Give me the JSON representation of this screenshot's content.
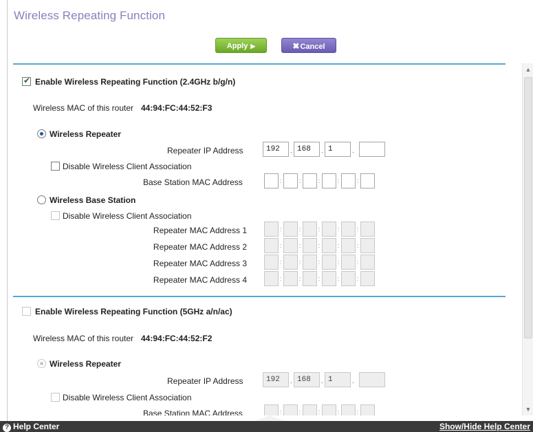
{
  "page": {
    "title": "Wireless Repeating Function",
    "apply_label": "Apply",
    "cancel_label": "Cancel"
  },
  "band24": {
    "enable_label": "Enable Wireless Repeating Function (2.4GHz b/g/n)",
    "enabled": true,
    "mac_prefix": "Wireless MAC of this router",
    "mac_value": "44:94:FC:44:52:F3",
    "repeater_label": "Wireless Repeater",
    "repeater_ip_label": "Repeater IP Address",
    "repeater_ip": [
      "192",
      "168",
      "1",
      ""
    ],
    "disable_assoc_label": "Disable Wireless Client Association",
    "base_mac_label": "Base Station MAC Address",
    "base_station_label": "Wireless Base Station",
    "base_disable_assoc_label": "Disable Wireless Client Association",
    "repeater_mac_labels": [
      "Repeater MAC Address 1",
      "Repeater MAC Address 2",
      "Repeater MAC Address 3",
      "Repeater MAC Address 4"
    ]
  },
  "band5": {
    "enable_label": "Enable Wireless Repeating Function (5GHz a/n/ac)",
    "enabled": false,
    "mac_prefix": "Wireless MAC of this router",
    "mac_value": "44:94:FC:44:52:F2",
    "repeater_label": "Wireless Repeater",
    "repeater_ip_label": "Repeater IP Address",
    "repeater_ip": [
      "192",
      "168",
      "1",
      ""
    ],
    "disable_assoc_label": "Disable Wireless Client Association",
    "base_mac_label": "Base Station MAC Address"
  },
  "footer": {
    "help_label": "Help Center",
    "toggle_label": "Show/Hide Help Center"
  },
  "colors": {
    "title": "#8a7fbd",
    "apply": "#7cba34",
    "cancel": "#7b6dc0",
    "rule": "#5aa7cf",
    "footer": "#3a3a3a"
  }
}
